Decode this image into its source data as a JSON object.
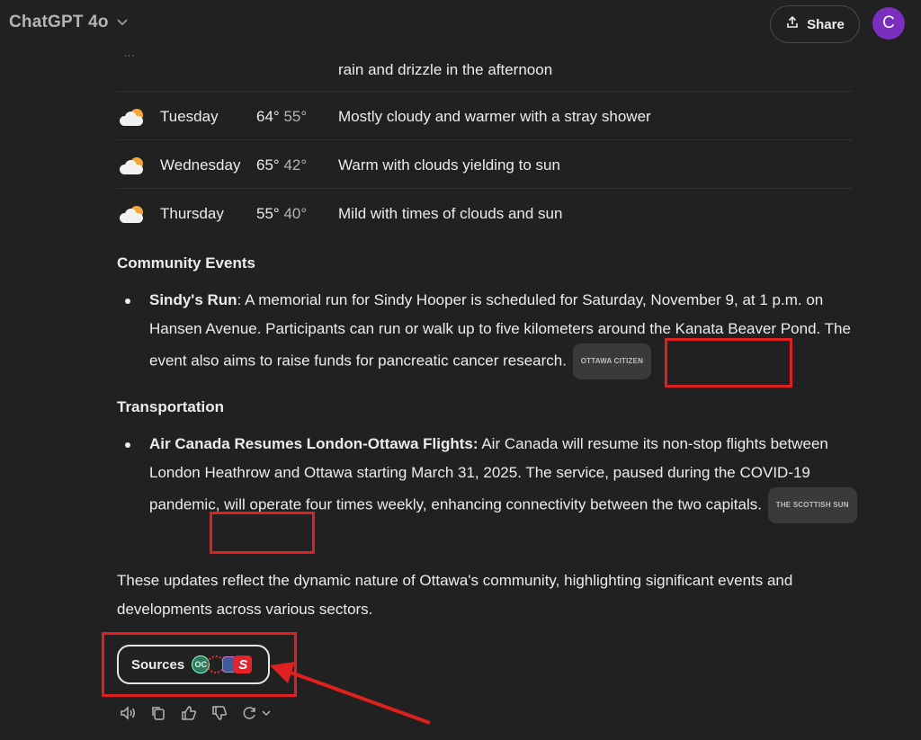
{
  "header": {
    "model_label": "ChatGPT 4o",
    "share_label": "Share",
    "avatar_letter": "C"
  },
  "weather": {
    "partial_desc": "rain and drizzle in the afternoon",
    "rows": [
      {
        "day": "Tuesday",
        "high": "64°",
        "low": "55°",
        "desc": "Mostly cloudy and warmer with a stray shower",
        "icon": "partly-cloudy-icon"
      },
      {
        "day": "Wednesday",
        "high": "65°",
        "low": "42°",
        "desc": "Warm with clouds yielding to sun",
        "icon": "partly-cloudy-icon"
      },
      {
        "day": "Thursday",
        "high": "55°",
        "low": "40°",
        "desc": "Mild with times of clouds and sun",
        "icon": "partly-cloudy-icon"
      }
    ]
  },
  "community": {
    "heading": "Community Events",
    "item_title": "Sindy's Run",
    "item_text": ": A memorial run for Sindy Hooper is scheduled for Saturday, November 9, at 1 p.m. on Hansen Avenue. Participants can run or walk up to five kilometers around the Kanata Beaver Pond. The event also aims to raise funds for pancreatic cancer research.",
    "citation": "OTTAWA CITIZEN"
  },
  "transportation": {
    "heading": "Transportation",
    "item_title": "Air Canada Resumes London-Ottawa Flights:",
    "item_text": " Air Canada will resume its non-stop flights between London Heathrow and Ottawa starting March 31, 2025. The service, paused during the COVID-19 pandemic, will operate four times weekly, enhancing connectivity between the two capitals.",
    "citation": "THE SCOTTISH SUN"
  },
  "closing": "These updates reflect the dynamic nature of Ottawa's community, highlighting significant events and developments across various sectors.",
  "sources": {
    "label": "Sources",
    "favicon_oc": "OC",
    "favicon_sun": "S"
  },
  "colors": {
    "background": "#212121",
    "annotation": "#e02020",
    "avatar": "#7b2fbf"
  }
}
